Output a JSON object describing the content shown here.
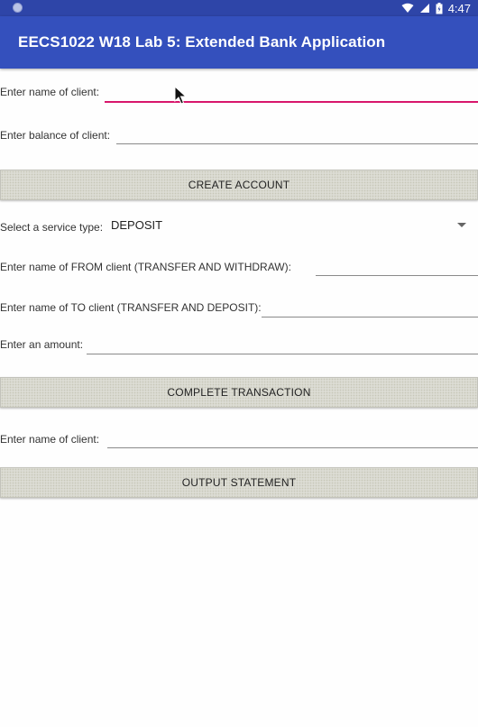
{
  "status_bar": {
    "time": "4:47"
  },
  "app_bar": {
    "title": "EECS1022 W18 Lab 5: Extended Bank Application"
  },
  "create_section": {
    "client_name_label": "Enter name of client:",
    "client_name_value": "",
    "balance_label": "Enter balance of client:",
    "balance_value": "",
    "create_button_label": "CREATE ACCOUNT"
  },
  "transaction_section": {
    "service_type_label": "Select a service type:",
    "service_type_selected": "DEPOSIT",
    "from_client_label": "Enter name of FROM client (TRANSFER AND WITHDRAW):",
    "from_client_value": "",
    "to_client_label": "Enter name of TO client (TRANSFER AND DEPOSIT):",
    "to_client_value": "",
    "amount_label": "Enter an amount:",
    "amount_value": "",
    "complete_button_label": "COMPLETE TRANSACTION"
  },
  "statement_section": {
    "client_name_label": "Enter name of client:",
    "client_name_value": "",
    "output_button_label": "OUTPUT STATEMENT"
  },
  "colors": {
    "status_bar": "#2e45a8",
    "app_bar": "#3450bd",
    "focused_field_underline": "#d8166b"
  }
}
